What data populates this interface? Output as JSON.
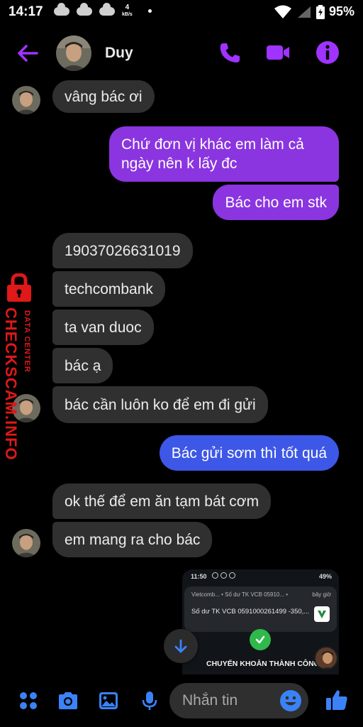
{
  "status_bar": {
    "time": "14:17",
    "net_speed_value": "4",
    "net_speed_unit": "kB/s",
    "battery": "95%"
  },
  "header": {
    "contact_name": "Duy",
    "accent_color": "#a033ff"
  },
  "messages": [
    {
      "direction": "in",
      "text": "vâng bác ơi"
    },
    {
      "direction": "out",
      "text_lines": [
        "Chứ đơn vị khác em làm cả",
        "ngày nên k lấy đc"
      ]
    },
    {
      "direction": "out",
      "text": "Bác cho em stk"
    },
    {
      "direction": "in",
      "text": "19037026631019"
    },
    {
      "direction": "in",
      "text": "techcombank"
    },
    {
      "direction": "in",
      "text": "ta van duoc"
    },
    {
      "direction": "in",
      "text": "bác ạ"
    },
    {
      "direction": "in",
      "text": "bác cần luôn ko để em đi gửi"
    },
    {
      "direction": "out",
      "text": "Bác gửi sơm thì tốt quá"
    },
    {
      "direction": "in",
      "text": "ok thế để em ăn tạm bát cơm"
    },
    {
      "direction": "in",
      "text": "em mang ra cho bác"
    }
  ],
  "watermark": {
    "main": "CHECKSCAM.INFO",
    "sub": "DATA CENTER"
  },
  "attachment": {
    "time": "11:50",
    "battery": "49%",
    "app_line": "Vietcomb... • Số dư TK VCB 05910... •",
    "app_time": "bây giờ",
    "body": "Số dư TK VCB 0591000261499 -350,...",
    "success_text": "CHUYỂN KHOẢN THÀNH CÔNG"
  },
  "composer": {
    "placeholder": "Nhắn tin"
  },
  "colors": {
    "outgoing_purple": "#8a35e0",
    "outgoing_blue": "#3d57e6",
    "incoming": "#303030",
    "icon_accent": "#a033ff",
    "composer_icon": "#3b82f6"
  }
}
